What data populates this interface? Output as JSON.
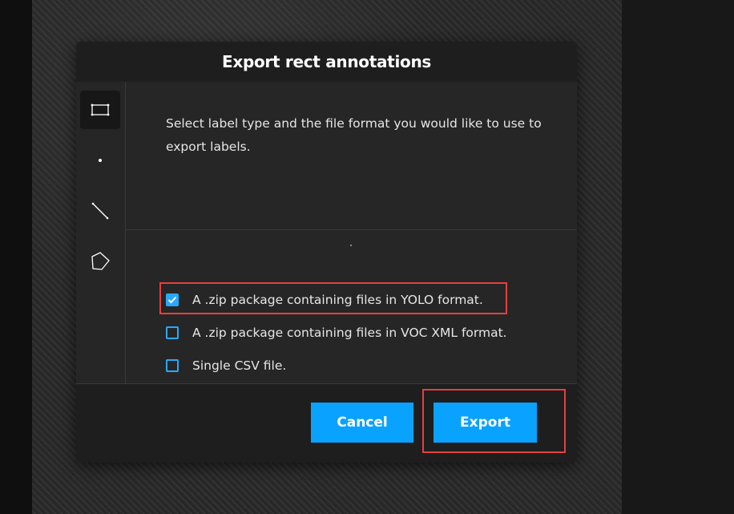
{
  "modal": {
    "title": "Export rect annotations",
    "description": "Select label type and the file format you would like to use to export labels."
  },
  "sidebar": {
    "items": [
      {
        "name": "rect",
        "icon": "rectangle-icon",
        "active": true
      },
      {
        "name": "point",
        "icon": "point-icon",
        "active": false
      },
      {
        "name": "line",
        "icon": "line-icon",
        "active": false
      },
      {
        "name": "polygon",
        "icon": "polygon-icon",
        "active": false
      }
    ]
  },
  "options": [
    {
      "label": "A .zip package containing files in YOLO format.",
      "checked": true
    },
    {
      "label": "A .zip package containing files in VOC XML format.",
      "checked": false
    },
    {
      "label": "Single CSV file.",
      "checked": false
    }
  ],
  "footer": {
    "cancel_label": "Cancel",
    "export_label": "Export"
  },
  "colors": {
    "accent": "#0aa2ff",
    "checkbox": "#29a8ff",
    "highlight": "#e5403d",
    "modal_bg": "#262626",
    "header_bg": "#1e1e1e"
  }
}
